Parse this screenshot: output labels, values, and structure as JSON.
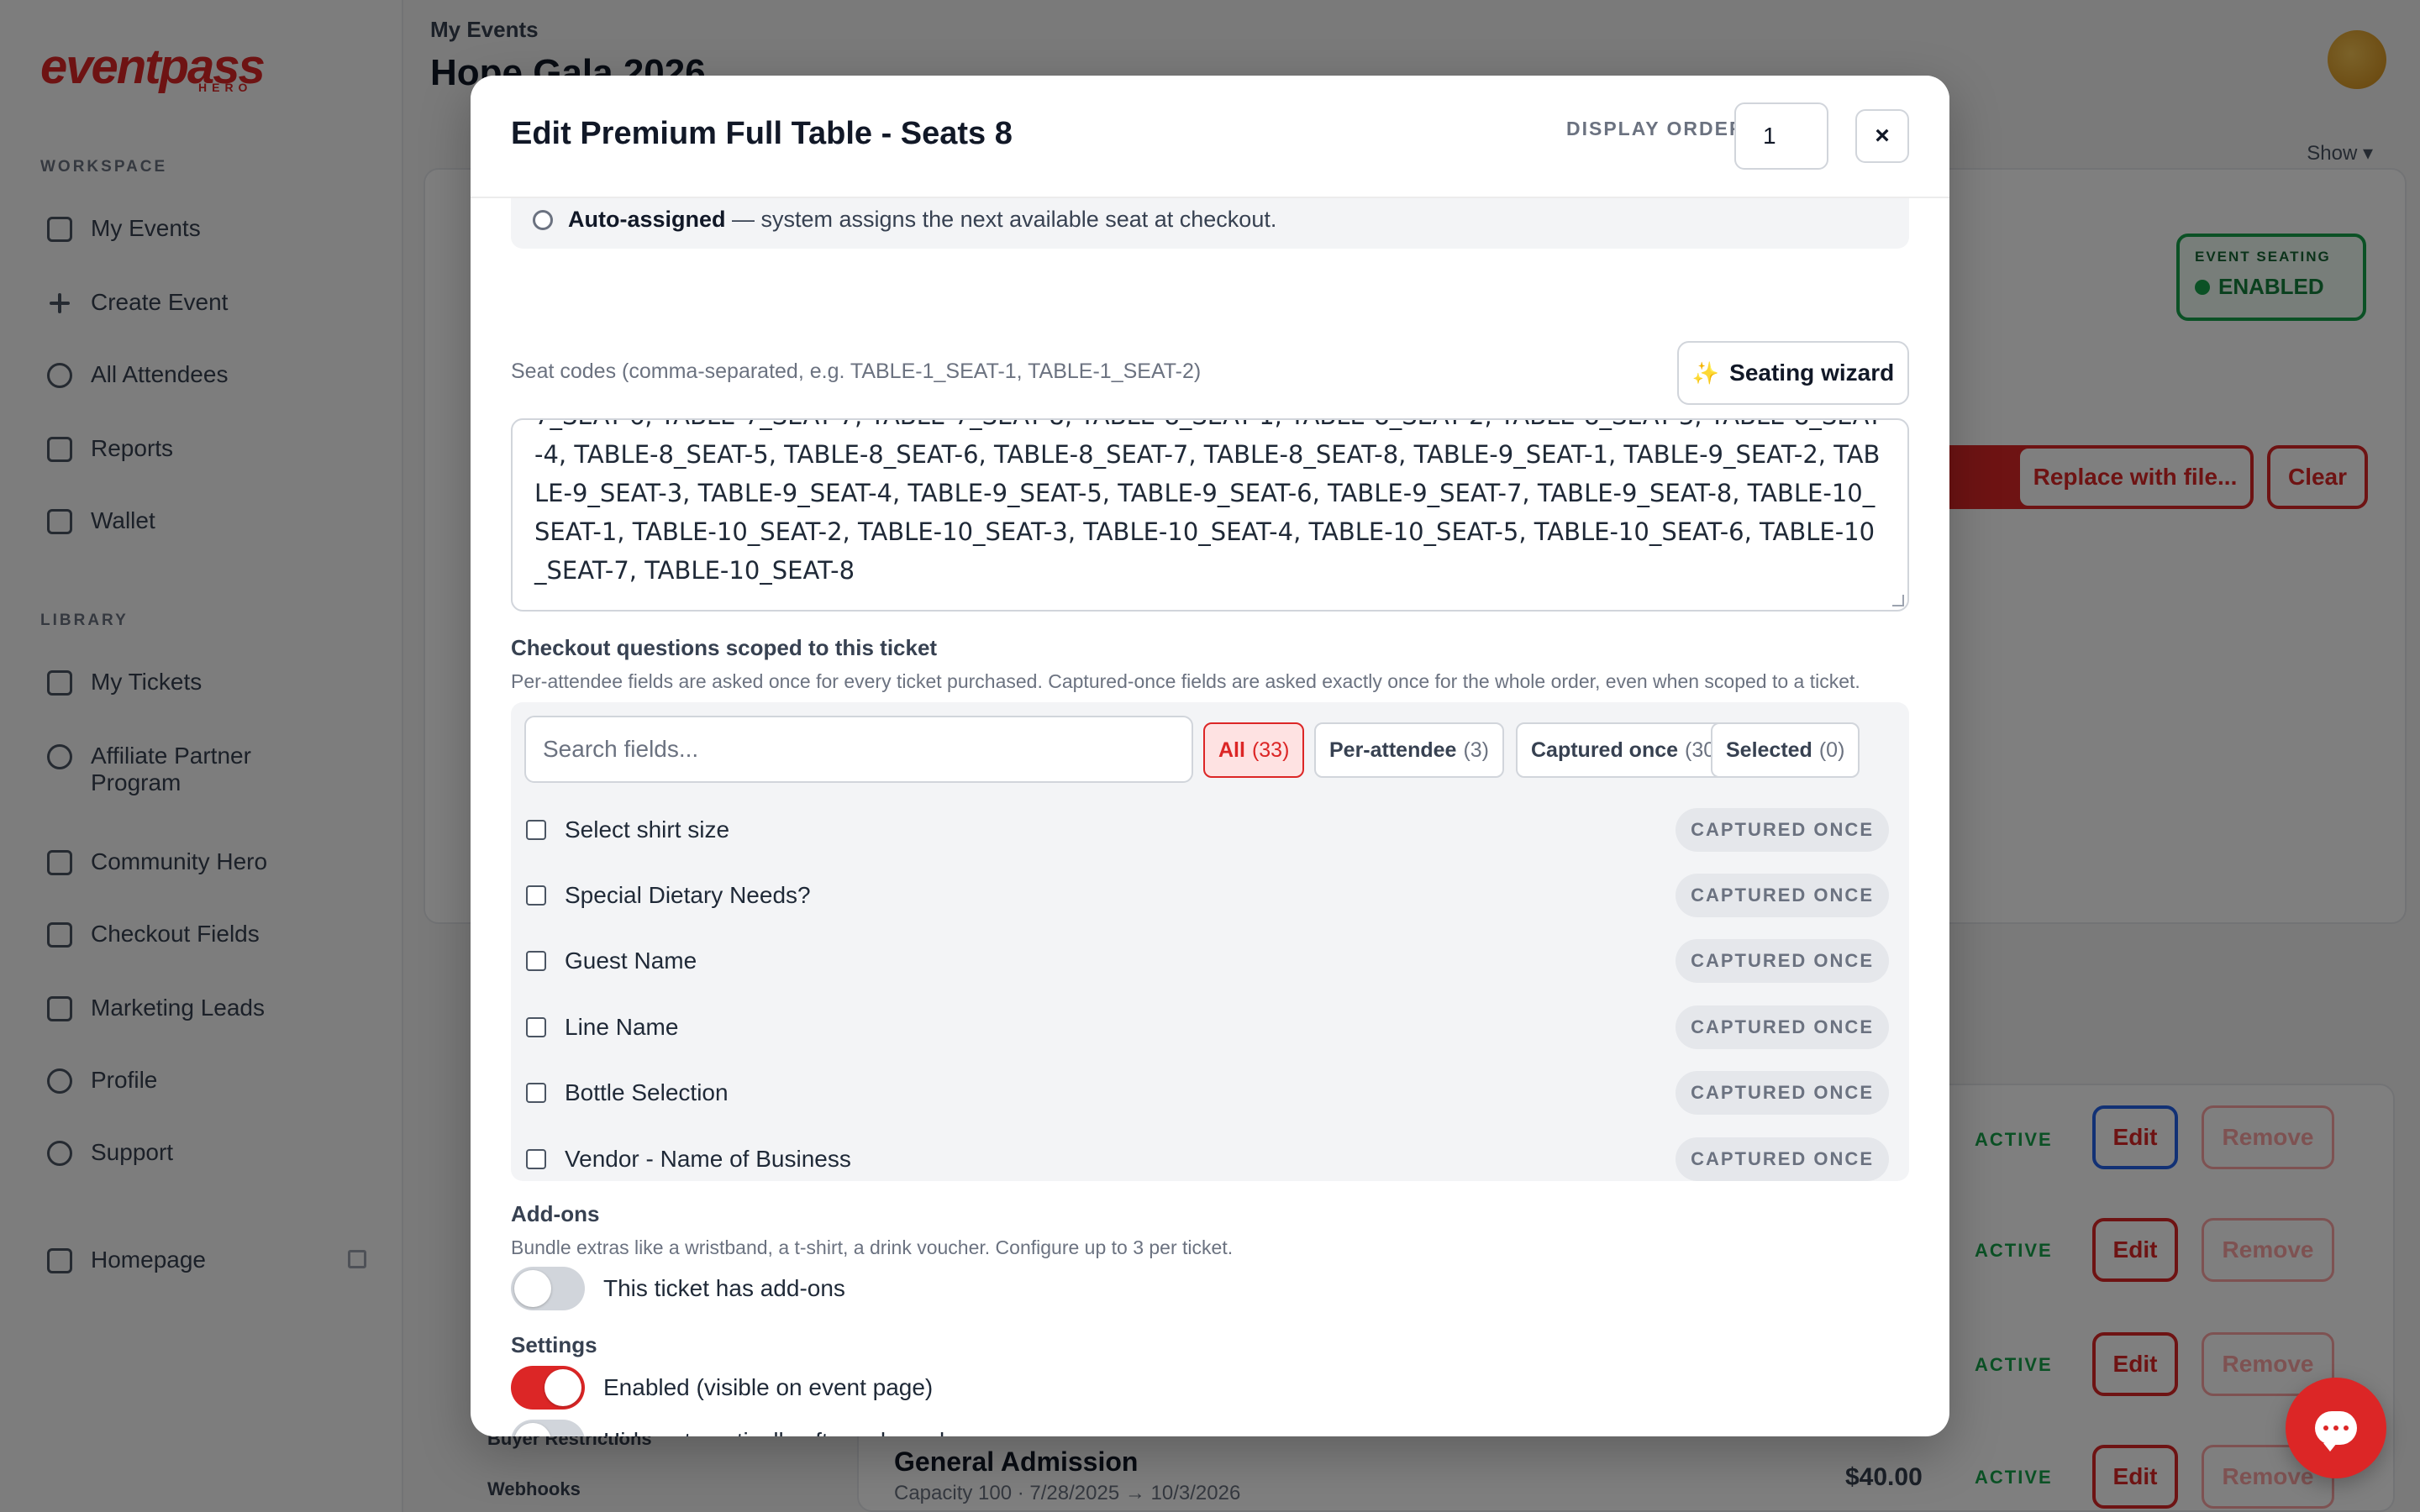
{
  "app": {
    "logo_text": "eventpass",
    "logo_sub": "HERO",
    "workspace_label": "WORKSPACE",
    "library_label": "LIBRARY",
    "workspace_items": [
      {
        "label": "My Events"
      },
      {
        "label": "Create Event"
      },
      {
        "label": "All Attendees"
      },
      {
        "label": "Reports"
      },
      {
        "label": "Wallet"
      }
    ],
    "library_items": [
      {
        "label": "My Tickets"
      },
      {
        "label": "Affiliate Partner Program"
      },
      {
        "label": "Community Hero"
      },
      {
        "label": "Checkout Fields"
      },
      {
        "label": "Marketing Leads"
      },
      {
        "label": "Profile"
      },
      {
        "label": "Support"
      }
    ],
    "homepage_label": "Homepage",
    "breadcrumb": "My Events",
    "page_title": "Hope Gala 2026",
    "show_label": "Show",
    "event_seating_label": "EVENT SEATING",
    "event_seating_value": "ENABLED",
    "btn_replace": "Replace with file...",
    "btn_clear": "Clear",
    "status_active": "ACTIVE",
    "btn_edit": "Edit",
    "btn_remove": "Remove",
    "ga_title": "General Admission",
    "ga_sub": "Capacity 100 · 7/28/2025 → 10/3/2026",
    "ga_price": "$40.00",
    "sub_links": [
      "Buyer Restrictions",
      "Webhooks"
    ]
  },
  "modal": {
    "title": "Edit Premium Full Table - Seats 8",
    "display_order_label": "DISPLAY ORDER",
    "display_order_value": "1",
    "close_label": "×",
    "radio_bold": "Auto-assigned",
    "radio_rest": " — system assigns the next available seat at checkout.",
    "seat_codes_label": "Seat codes (comma-separated, e.g. TABLE-1_SEAT-1, TABLE-1_SEAT-2)",
    "seating_wizard_label": "Seating wizard",
    "seat_codes_value": "7_SEAT-6, TABLE-7_SEAT-7, TABLE-7_SEAT-8, TABLE-8_SEAT-1, TABLE-8_SEAT-2, TABLE-8_SEAT-3, TABLE-8_SEAT-4, TABLE-8_SEAT-5, TABLE-8_SEAT-6, TABLE-8_SEAT-7, TABLE-8_SEAT-8, TABLE-9_SEAT-1, TABLE-9_SEAT-2, TABLE-9_SEAT-3, TABLE-9_SEAT-4, TABLE-9_SEAT-5, TABLE-9_SEAT-6, TABLE-9_SEAT-7, TABLE-9_SEAT-8, TABLE-10_SEAT-1, TABLE-10_SEAT-2, TABLE-10_SEAT-3, TABLE-10_SEAT-4, TABLE-10_SEAT-5, TABLE-10_SEAT-6, TABLE-10_SEAT-7, TABLE-10_SEAT-8",
    "checkout_heading": "Checkout questions scoped to this ticket",
    "checkout_desc": "Per-attendee fields are asked once for every ticket purchased. Captured-once fields are asked exactly once for the whole order, even when scoped to a ticket.",
    "search_placeholder": "Search fields...",
    "filters": [
      {
        "label": "All",
        "count": "(33)"
      },
      {
        "label": "Per-attendee",
        "count": "(3)"
      },
      {
        "label": "Captured once",
        "count": "(30)"
      },
      {
        "label": "Selected",
        "count": "(0)"
      }
    ],
    "fields": [
      {
        "name": "Select shirt size",
        "badge": "CAPTURED ONCE"
      },
      {
        "name": "Special Dietary Needs?",
        "badge": "CAPTURED ONCE"
      },
      {
        "name": "Guest Name",
        "badge": "CAPTURED ONCE"
      },
      {
        "name": "Line Name",
        "badge": "CAPTURED ONCE"
      },
      {
        "name": "Bottle Selection",
        "badge": "CAPTURED ONCE"
      },
      {
        "name": "Vendor - Name of Business",
        "badge": "CAPTURED ONCE"
      }
    ],
    "addons_heading": "Add-ons",
    "addons_desc": "Bundle extras like a wristband, a t-shirt, a drink voucher. Configure up to 3 per ticket.",
    "addons_toggle_label": "This ticket has add-ons",
    "settings_heading": "Settings",
    "enabled_toggle_label": "Enabled (visible on event page)",
    "hide_toggle_label": "Hide automatically after sale ends"
  },
  "colors": {
    "accent": "#dc2626",
    "success": "#16a34a"
  }
}
